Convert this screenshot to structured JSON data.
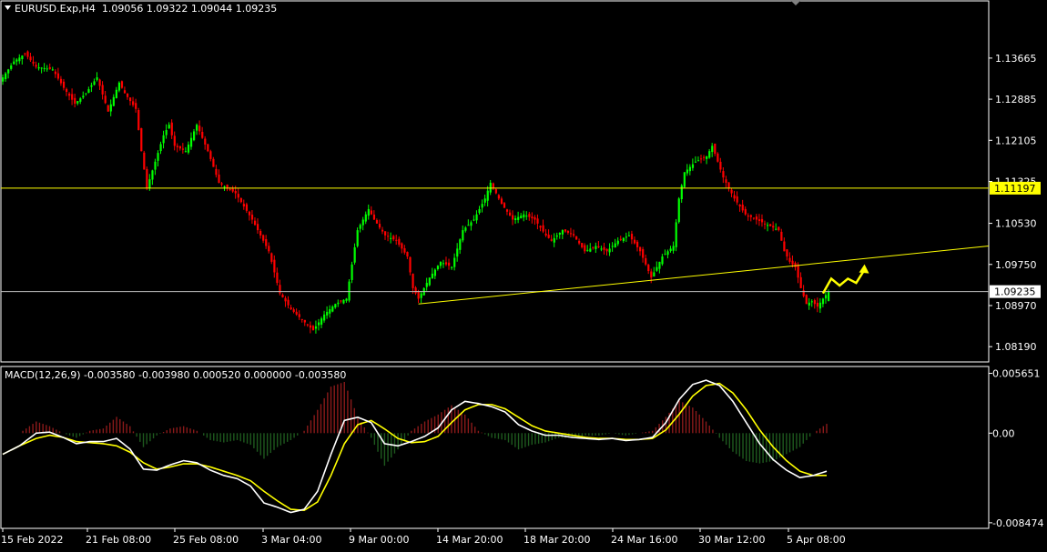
{
  "header": {
    "symbol_line": "EURUSD.Exp,H4  1.09056 1.09322 1.09044 1.09235",
    "macd_line": "MACD(12,26,9) -0.003580 -0.003980 0.000520 0.000000 -0.003580"
  },
  "colors": {
    "background": "#000000",
    "bull": "#00ff00",
    "bear": "#ff0000",
    "frame": "#ffffff",
    "level_line": "#ffff00",
    "current_line": "#c0c0c0",
    "macd_line": "#ffffff",
    "signal_line": "#ffff00",
    "hist_pos": "#8b1a1a",
    "hist_neg": "#1e5a1e",
    "arrow": "#ffff00"
  },
  "chart_data": [
    {
      "type": "candlestick",
      "symbol": "EURUSD.Exp",
      "timeframe": "H4",
      "ohlc_current": {
        "open": 1.09056,
        "high": 1.09322,
        "low": 1.09044,
        "close": 1.09235
      },
      "y_ticks": [
        "1.13665",
        "1.12885",
        "1.12105",
        "1.11325",
        "1.10530",
        "1.09750",
        "1.08970",
        "1.08190"
      ],
      "ylim": [
        1.079,
        1.1475
      ],
      "horizontal_level": {
        "value": 1.11197,
        "label": "1.11197"
      },
      "current_price": {
        "value": 1.09235,
        "label": "1.09235"
      },
      "trendline": {
        "from": {
          "date": "10 Mar 2022",
          "price": 1.09
        },
        "to": {
          "date": "8 Apr 2022",
          "price": 1.101
        }
      },
      "x_ticks": [
        "15 Feb 2022",
        "21 Feb 08:00",
        "25 Feb 08:00",
        "3 Mar 04:00",
        "9 Mar 00:00",
        "14 Mar 20:00",
        "18 Mar 20:00",
        "24 Mar 16:00",
        "30 Mar 12:00",
        "5 Apr 08:00"
      ],
      "price_path": [
        [
          0,
          1.133
        ],
        [
          4,
          1.136
        ],
        [
          8,
          1.1375
        ],
        [
          12,
          1.135
        ],
        [
          18,
          1.1345
        ],
        [
          22,
          1.131
        ],
        [
          26,
          1.128
        ],
        [
          30,
          1.13
        ],
        [
          34,
          1.133
        ],
        [
          38,
          1.1265
        ],
        [
          42,
          1.132
        ],
        [
          44,
          1.13
        ],
        [
          48,
          1.127
        ],
        [
          50,
          1.119
        ],
        [
          52,
          1.112
        ],
        [
          55,
          1.117
        ],
        [
          58,
          1.122
        ],
        [
          60,
          1.124
        ],
        [
          62,
          1.12
        ],
        [
          66,
          1.119
        ],
        [
          70,
          1.124
        ],
        [
          74,
          1.119
        ],
        [
          78,
          1.113
        ],
        [
          84,
          1.111
        ],
        [
          90,
          1.106
        ],
        [
          96,
          1.1
        ],
        [
          100,
          1.092
        ],
        [
          104,
          1.089
        ],
        [
          108,
          1.087
        ],
        [
          112,
          1.085
        ],
        [
          116,
          1.088
        ],
        [
          120,
          1.09
        ],
        [
          124,
          1.091
        ],
        [
          128,
          1.104
        ],
        [
          132,
          1.108
        ],
        [
          134,
          1.106
        ],
        [
          138,
          1.103
        ],
        [
          142,
          1.102
        ],
        [
          146,
          1.099
        ],
        [
          148,
          1.093
        ],
        [
          150,
          1.091
        ],
        [
          154,
          1.095
        ],
        [
          158,
          1.098
        ],
        [
          162,
          1.097
        ],
        [
          166,
          1.104
        ],
        [
          170,
          1.106
        ],
        [
          174,
          1.11
        ],
        [
          176,
          1.113
        ],
        [
          180,
          1.109
        ],
        [
          184,
          1.106
        ],
        [
          188,
          1.107
        ],
        [
          192,
          1.106
        ],
        [
          196,
          1.103
        ],
        [
          198,
          1.102
        ],
        [
          202,
          1.104
        ],
        [
          206,
          1.103
        ],
        [
          210,
          1.1
        ],
        [
          214,
          1.101
        ],
        [
          218,
          1.1
        ],
        [
          222,
          1.102
        ],
        [
          226,
          1.103
        ],
        [
          230,
          1.1
        ],
        [
          234,
          1.095
        ],
        [
          238,
          1.099
        ],
        [
          242,
          1.101
        ],
        [
          244,
          1.11
        ],
        [
          246,
          1.115
        ],
        [
          250,
          1.117
        ],
        [
          254,
          1.118
        ],
        [
          256,
          1.12
        ],
        [
          260,
          1.114
        ],
        [
          264,
          1.11
        ],
        [
          268,
          1.107
        ],
        [
          272,
          1.106
        ],
        [
          276,
          1.105
        ],
        [
          280,
          1.104
        ],
        [
          282,
          1.1
        ],
        [
          284,
          1.098
        ],
        [
          286,
          1.097
        ],
        [
          288,
          1.093
        ],
        [
          290,
          1.09
        ],
        [
          292,
          1.0905
        ],
        [
          294,
          1.0895
        ],
        [
          296,
          1.091
        ],
        [
          298,
          1.0924
        ]
      ]
    },
    {
      "type": "macd",
      "params": "12,26,9",
      "y_ticks": [
        "0.005651",
        "0.00",
        "-0.008474"
      ],
      "ylim": [
        -0.009,
        0.0063
      ],
      "macd": [
        [
          0,
          -0.002
        ],
        [
          5,
          -0.0012
        ],
        [
          10,
          0.0
        ],
        [
          14,
          0.0001
        ],
        [
          18,
          -0.0004
        ],
        [
          22,
          -0.001
        ],
        [
          26,
          -0.0008
        ],
        [
          30,
          -0.0008
        ],
        [
          34,
          -0.0005
        ],
        [
          38,
          -0.0015
        ],
        [
          42,
          -0.0034
        ],
        [
          46,
          -0.0035
        ],
        [
          50,
          -0.003
        ],
        [
          54,
          -0.0026
        ],
        [
          58,
          -0.0028
        ],
        [
          62,
          -0.0035
        ],
        [
          66,
          -0.004
        ],
        [
          70,
          -0.0043
        ],
        [
          74,
          -0.005
        ],
        [
          78,
          -0.0066
        ],
        [
          82,
          -0.007
        ],
        [
          86,
          -0.0075
        ],
        [
          90,
          -0.0072
        ],
        [
          94,
          -0.0055
        ],
        [
          98,
          -0.002
        ],
        [
          102,
          0.0012
        ],
        [
          106,
          0.0015
        ],
        [
          110,
          0.001
        ],
        [
          114,
          -0.001
        ],
        [
          118,
          -0.0012
        ],
        [
          122,
          -0.0008
        ],
        [
          126,
          -0.0003
        ],
        [
          130,
          0.0005
        ],
        [
          134,
          0.0022
        ],
        [
          138,
          0.003
        ],
        [
          142,
          0.0028
        ],
        [
          146,
          0.0025
        ],
        [
          150,
          0.002
        ],
        [
          154,
          0.0008
        ],
        [
          158,
          0.0002
        ],
        [
          162,
          -0.0002
        ],
        [
          166,
          -0.0002
        ],
        [
          170,
          -0.0004
        ],
        [
          174,
          -0.0005
        ],
        [
          178,
          -0.0006
        ],
        [
          182,
          -0.0005
        ],
        [
          186,
          -0.0007
        ],
        [
          190,
          -0.0006
        ],
        [
          194,
          -0.0004
        ],
        [
          198,
          0.001
        ],
        [
          202,
          0.0032
        ],
        [
          206,
          0.0046
        ],
        [
          210,
          0.005
        ],
        [
          214,
          0.0045
        ],
        [
          218,
          0.003
        ],
        [
          222,
          0.001
        ],
        [
          226,
          -0.001
        ],
        [
          230,
          -0.0025
        ],
        [
          234,
          -0.0035
        ],
        [
          238,
          -0.0042
        ],
        [
          242,
          -0.004
        ],
        [
          246,
          -0.0036
        ]
      ],
      "signal": [
        [
          0,
          -0.002
        ],
        [
          5,
          -0.0012
        ],
        [
          10,
          -0.0005
        ],
        [
          14,
          -0.0002
        ],
        [
          18,
          -0.0004
        ],
        [
          22,
          -0.0008
        ],
        [
          26,
          -0.0009
        ],
        [
          30,
          -0.001
        ],
        [
          34,
          -0.0012
        ],
        [
          38,
          -0.0018
        ],
        [
          42,
          -0.0028
        ],
        [
          46,
          -0.0034
        ],
        [
          50,
          -0.0032
        ],
        [
          54,
          -0.0029
        ],
        [
          58,
          -0.0029
        ],
        [
          62,
          -0.0032
        ],
        [
          66,
          -0.0036
        ],
        [
          70,
          -0.004
        ],
        [
          74,
          -0.0045
        ],
        [
          78,
          -0.0055
        ],
        [
          82,
          -0.0064
        ],
        [
          86,
          -0.0072
        ],
        [
          90,
          -0.0073
        ],
        [
          94,
          -0.0065
        ],
        [
          98,
          -0.004
        ],
        [
          102,
          -0.001
        ],
        [
          106,
          0.0008
        ],
        [
          110,
          0.0012
        ],
        [
          114,
          0.0004
        ],
        [
          118,
          -0.0005
        ],
        [
          122,
          -0.0009
        ],
        [
          126,
          -0.0008
        ],
        [
          130,
          -0.0003
        ],
        [
          134,
          0.001
        ],
        [
          138,
          0.0022
        ],
        [
          142,
          0.0027
        ],
        [
          146,
          0.0027
        ],
        [
          150,
          0.0023
        ],
        [
          154,
          0.0015
        ],
        [
          158,
          0.0007
        ],
        [
          162,
          0.0002
        ],
        [
          166,
          0.0
        ],
        [
          170,
          -0.0002
        ],
        [
          174,
          -0.0004
        ],
        [
          178,
          -0.0005
        ],
        [
          182,
          -0.0005
        ],
        [
          186,
          -0.0006
        ],
        [
          190,
          -0.0006
        ],
        [
          194,
          -0.0005
        ],
        [
          198,
          0.0003
        ],
        [
          202,
          0.0018
        ],
        [
          206,
          0.0035
        ],
        [
          210,
          0.0045
        ],
        [
          214,
          0.0047
        ],
        [
          218,
          0.0038
        ],
        [
          222,
          0.0022
        ],
        [
          226,
          0.0003
        ],
        [
          230,
          -0.0013
        ],
        [
          234,
          -0.0026
        ],
        [
          238,
          -0.0036
        ],
        [
          242,
          -0.004
        ],
        [
          246,
          -0.004
        ]
      ]
    }
  ]
}
